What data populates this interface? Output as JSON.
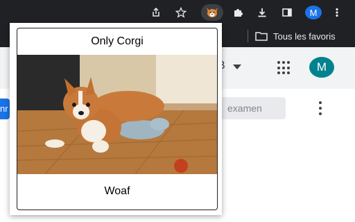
{
  "toolbar": {
    "icons": [
      "share-icon",
      "star-icon",
      "corgi-extension-icon",
      "puzzle-icon",
      "download-icon",
      "side-panel-icon",
      "profile-avatar",
      "more-vert-icon"
    ],
    "profile_initial": "M"
  },
  "bookmarks": {
    "folder_label": "Tous les favoris"
  },
  "page": {
    "header_letter": "B",
    "avatar_initial": "M",
    "left_button_text": "nr",
    "search_placeholder": "examen"
  },
  "popup": {
    "title": "Only Corgi",
    "image_alt": "Corgi puppy lying on a wooden floor",
    "footer": "Woaf"
  },
  "colors": {
    "chrome_dark": "#202124",
    "avatar_blue": "#1a73e8",
    "avatar_teal": "#00838f",
    "accent_blue": "#1a73e8"
  }
}
